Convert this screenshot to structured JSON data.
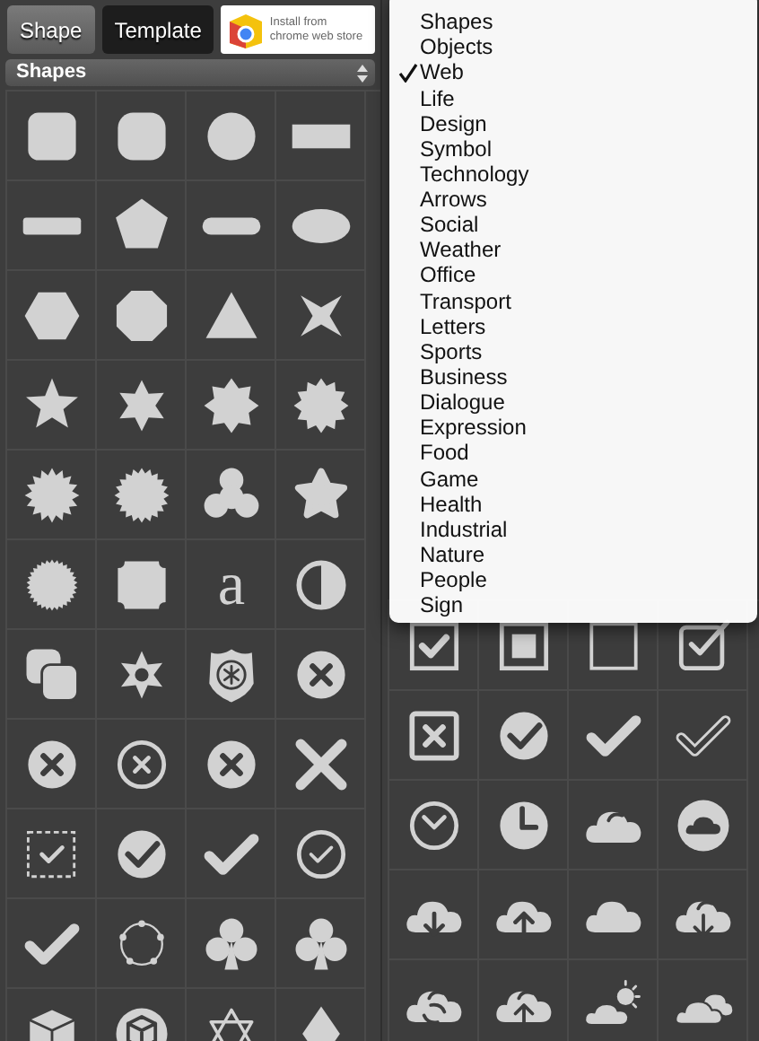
{
  "left_panel": {
    "tabs": [
      {
        "label": "Shape",
        "selected": true
      },
      {
        "label": "Template",
        "selected": false
      }
    ],
    "store_badge": {
      "line_1": "Install from",
      "line_2": "chrome web store"
    },
    "category_select": {
      "value": "Shapes"
    },
    "shapes": [
      {
        "kind": "rounded-square"
      },
      {
        "kind": "squircle"
      },
      {
        "kind": "circle"
      },
      {
        "kind": "rectangle"
      },
      {
        "kind": "bar"
      },
      {
        "kind": "pentagon"
      },
      {
        "kind": "pill"
      },
      {
        "kind": "ellipse"
      },
      {
        "kind": "hexagon"
      },
      {
        "kind": "octagon"
      },
      {
        "kind": "triangle"
      },
      {
        "kind": "star4"
      },
      {
        "kind": "star5"
      },
      {
        "kind": "star6"
      },
      {
        "kind": "star8"
      },
      {
        "kind": "star12"
      },
      {
        "kind": "burst16"
      },
      {
        "kind": "burst20"
      },
      {
        "kind": "trefoil"
      },
      {
        "kind": "rounded-star"
      },
      {
        "kind": "seal"
      },
      {
        "kind": "notched-square"
      },
      {
        "kind": "letter",
        "text": "a"
      },
      {
        "kind": "half-circle"
      },
      {
        "kind": "overlap-squares"
      },
      {
        "kind": "sheriff-star"
      },
      {
        "kind": "police-badge"
      },
      {
        "kind": "x-circle"
      },
      {
        "kind": "x-circle"
      },
      {
        "kind": "x-circle-outline"
      },
      {
        "kind": "x-circle"
      },
      {
        "kind": "x-mark"
      },
      {
        "kind": "dashed-check"
      },
      {
        "kind": "check-circle"
      },
      {
        "kind": "check"
      },
      {
        "kind": "check-circle-outline"
      },
      {
        "kind": "check"
      },
      {
        "kind": "ring-nodes"
      },
      {
        "kind": "club"
      },
      {
        "kind": "club"
      },
      {
        "kind": "cube"
      },
      {
        "kind": "cube-circle"
      },
      {
        "kind": "hexagram"
      },
      {
        "kind": "diamond"
      }
    ]
  },
  "right_panel": {
    "icons": [
      {
        "kind": "check-box"
      },
      {
        "kind": "square-dot-box"
      },
      {
        "kind": "empty-box"
      },
      {
        "kind": "check-box-outline"
      },
      {
        "kind": "x-box"
      },
      {
        "kind": "check-circle"
      },
      {
        "kind": "check"
      },
      {
        "kind": "check-outline"
      },
      {
        "kind": "clock-outline"
      },
      {
        "kind": "clock"
      },
      {
        "kind": "cloud-swirl"
      },
      {
        "kind": "cloud-circle"
      },
      {
        "kind": "cloud-download"
      },
      {
        "kind": "cloud-upload"
      },
      {
        "kind": "cloud"
      },
      {
        "kind": "cloud-download-swirl"
      },
      {
        "kind": "cloud-sync"
      },
      {
        "kind": "cloud-upload-swirl"
      },
      {
        "kind": "cloud-sun"
      },
      {
        "kind": "clouds"
      }
    ]
  },
  "category_menu": {
    "items": [
      {
        "label": "Shapes",
        "selected": false
      },
      {
        "label": "Objects",
        "selected": false
      },
      {
        "label": "Web",
        "selected": true
      },
      {
        "label": "Life",
        "selected": false
      },
      {
        "label": "Design",
        "selected": false
      },
      {
        "label": "Symbol",
        "selected": false
      },
      {
        "label": "Technology",
        "selected": false
      },
      {
        "label": "Arrows",
        "selected": false
      },
      {
        "label": "Social",
        "selected": false
      },
      {
        "label": "Weather",
        "selected": false
      },
      {
        "label": "Office",
        "selected": false
      },
      {
        "label": "Transport",
        "selected": false
      },
      {
        "label": "Letters",
        "selected": false
      },
      {
        "label": "Sports",
        "selected": false
      },
      {
        "label": "Business",
        "selected": false
      },
      {
        "label": "Dialogue",
        "selected": false
      },
      {
        "label": "Expression",
        "selected": false
      },
      {
        "label": "Food",
        "selected": false
      },
      {
        "label": "Game",
        "selected": false
      },
      {
        "label": "Health",
        "selected": false
      },
      {
        "label": "Industrial",
        "selected": false
      },
      {
        "label": "Nature",
        "selected": false
      },
      {
        "label": "People",
        "selected": false
      },
      {
        "label": "Sign",
        "selected": false
      }
    ]
  }
}
